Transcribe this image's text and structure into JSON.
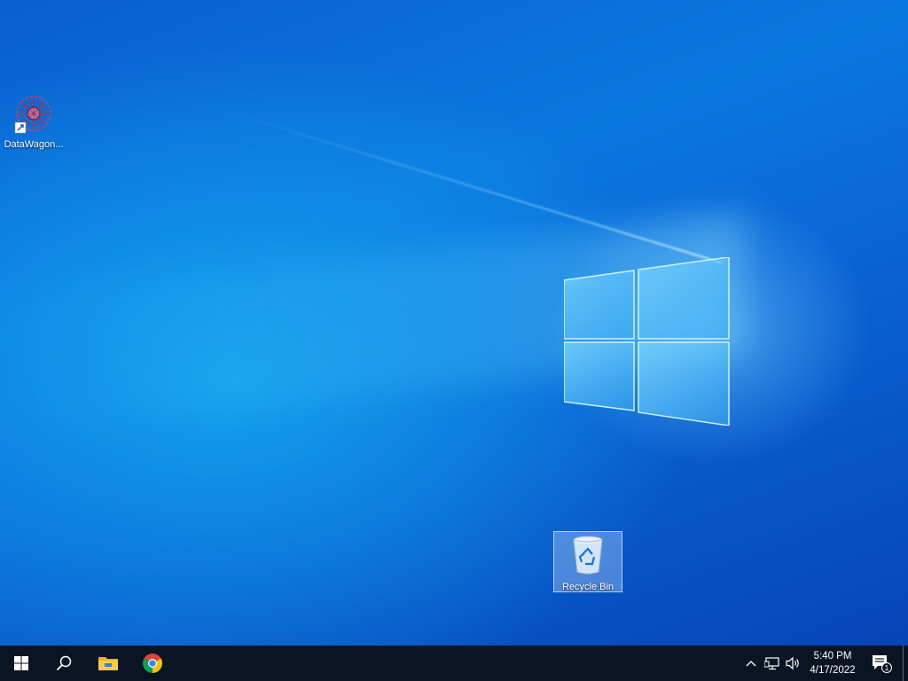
{
  "desktop": {
    "icons": [
      {
        "label": "DataWagon...",
        "icon": "datawagon-app-icon",
        "shortcut": true
      },
      {
        "label": "Recycle Bin",
        "icon": "recycle-bin-icon",
        "selected": true
      }
    ]
  },
  "taskbar": {
    "start": {
      "icon": "windows-start-icon"
    },
    "search": {
      "icon": "search-icon"
    },
    "pinned": [
      {
        "name": "File Explorer",
        "icon": "file-explorer-icon"
      },
      {
        "name": "Google Chrome",
        "icon": "chrome-icon"
      }
    ],
    "tray": {
      "chevron_icon": "chevron-up-icon",
      "network_icon": "network-icon",
      "volume_icon": "volume-icon",
      "time": "5:40 PM",
      "date": "4/17/2022",
      "notification_icon": "action-center-icon",
      "notification_count": "1"
    }
  },
  "colors": {
    "taskbar_bg": "#0b1422",
    "desktop_accent": "#0b78e0"
  }
}
